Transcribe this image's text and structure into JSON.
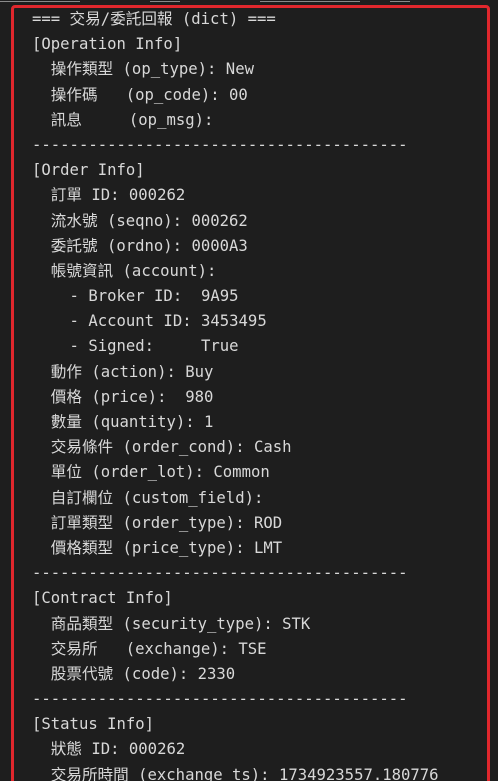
{
  "output": {
    "lines": [
      "=== 交易/委託回報 (dict) ===",
      "[Operation Info]",
      "  操作類型 (op_type): New",
      "  操作碼   (op_code): 00",
      "  訊息     (op_msg):",
      "----------------------------------------",
      "[Order Info]",
      "  訂單 ID: 000262",
      "  流水號 (seqno): 000262",
      "  委託號 (ordno): 0000A3",
      "  帳號資訊 (account):",
      "    - Broker ID:  9A95",
      "    - Account ID: 3453495",
      "    - Signed:     True",
      "  動作 (action): Buy",
      "  價格 (price):  980",
      "  數量 (quantity): 1",
      "  交易條件 (order_cond): Cash",
      "  單位 (order_lot): Common",
      "  自訂欄位 (custom_field):",
      "  訂單類型 (order_type): ROD",
      "  價格類型 (price_type): LMT",
      "----------------------------------------",
      "[Contract Info]",
      "  商品類型 (security_type): STK",
      "  交易所   (exchange): TSE",
      "  股票代號 (code): 2330",
      "----------------------------------------",
      "[Status Info]",
      "  狀態 ID: 000262",
      "  交易所時間 (exchange_ts): 1734923557.180776"
    ]
  },
  "colors": {
    "background": "#1e1e1e",
    "text": "#d8d8d8",
    "highlight_border": "#e0272d"
  }
}
